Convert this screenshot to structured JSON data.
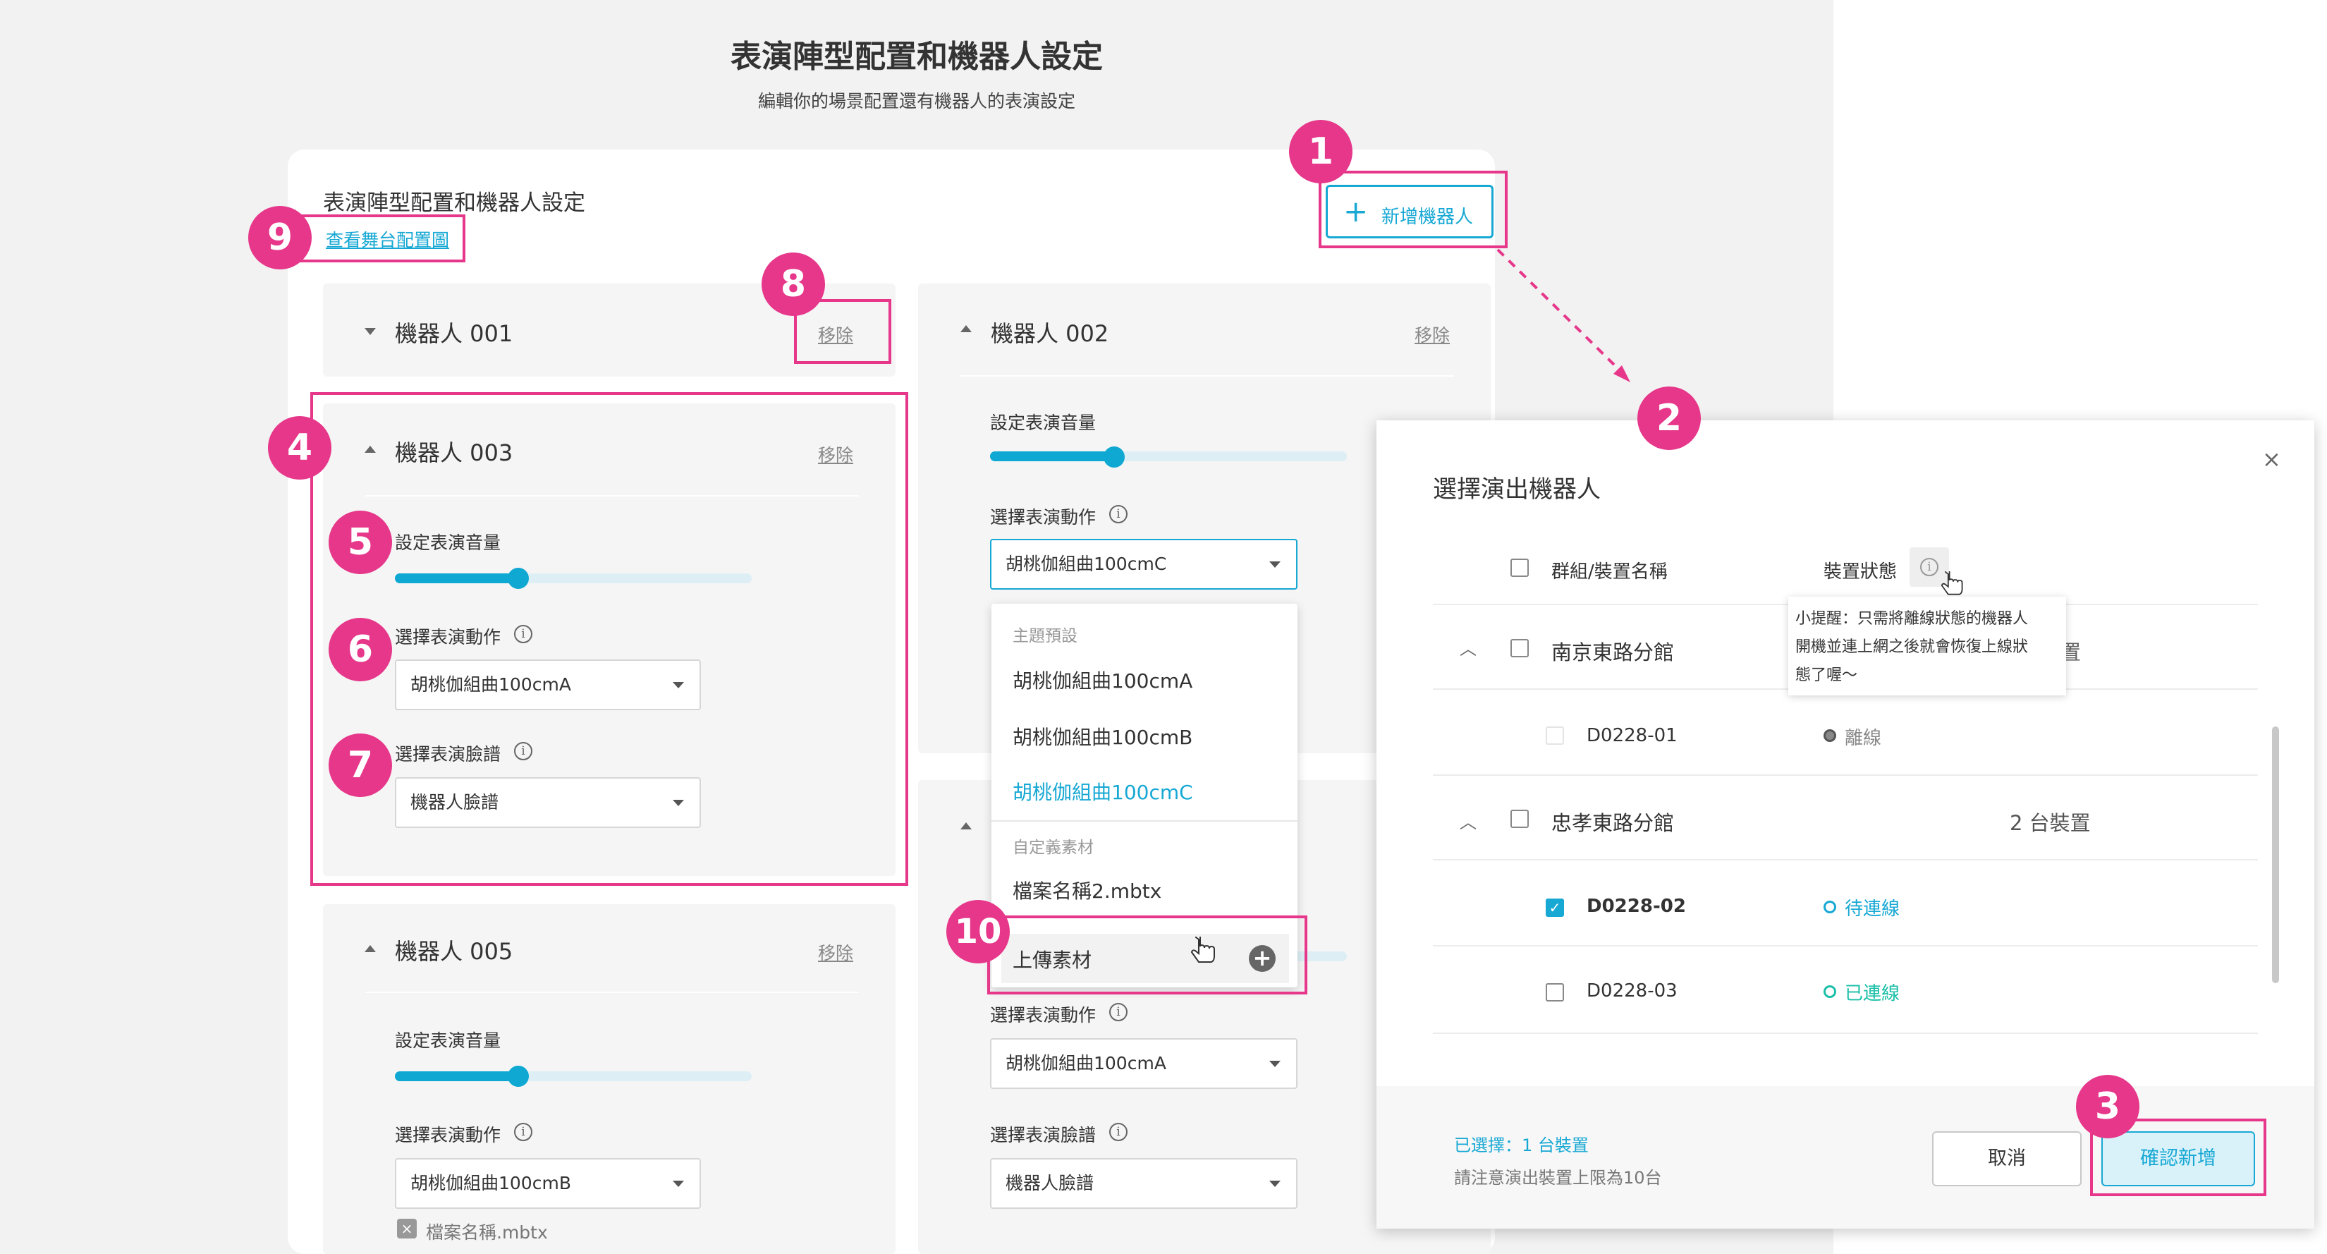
{
  "page": {
    "title": "表演陣型配置和機器人設定",
    "subtitle": "編輯你的場景配置還有機器人的表演設定"
  },
  "card": {
    "title": "表演陣型配置和機器人設定",
    "stage_link": "查看舞台配置圖",
    "add_robot_label": "新增機器人"
  },
  "common": {
    "remove_label": "移除",
    "volume_label": "設定表演音量",
    "action_label": "選擇表演動作",
    "face_label": "選擇表演臉譜"
  },
  "robots": [
    {
      "name": "機器人 001",
      "collapsed": true
    },
    {
      "name": "機器人 003",
      "volume": 0.4,
      "action": "胡桃伽組曲100cmA",
      "face": "機器人臉譜"
    },
    {
      "name": "機器人 005",
      "volume": 0.4,
      "action": "胡桃伽組曲100cmB",
      "file": "檔案名稱.mbtx"
    },
    {
      "name": "機器人 002",
      "volume": 0.35,
      "action": "胡桃伽組曲100cmC"
    },
    {
      "action": "胡桃伽組曲100cmA",
      "face": "機器人臉譜"
    }
  ],
  "dropdown": {
    "group1": "主題預設",
    "items": [
      "胡桃伽組曲100cmA",
      "胡桃伽組曲100cmB",
      "胡桃伽組曲100cmC"
    ],
    "selected_index": 2,
    "group2": "自定義素材",
    "custom_item": "檔案名稱2.mbtx",
    "upload_label": "上傳素材"
  },
  "modal": {
    "title": "選擇演出機器人",
    "close_icon": "×",
    "col_name": "群組/裝置名稱",
    "col_status": "裝置狀態",
    "tooltip_lines": [
      "小提醒：只需將離線狀態的機器人",
      "開機並連上網之後就會恢復上線狀",
      "態了喔～"
    ],
    "tooltip_hidden_text": "置",
    "groups": [
      {
        "name": "南京東路分館",
        "devices": [
          {
            "id": "D0228-01",
            "status": "離線",
            "checked": false,
            "disabled": true
          }
        ]
      },
      {
        "name": "忠孝東路分館",
        "count": "2 台裝置",
        "devices": [
          {
            "id": "D0228-02",
            "status": "待連線",
            "checked": true
          },
          {
            "id": "D0228-03",
            "status": "已連線",
            "checked": false
          }
        ]
      }
    ],
    "selected_text": "已選擇：1 台裝置",
    "limit_text": "請注意演出裝置上限為10台",
    "cancel_label": "取消",
    "confirm_label": "確認新增"
  },
  "badges": [
    "1",
    "2",
    "3",
    "4",
    "5",
    "6",
    "7",
    "8",
    "9",
    "10"
  ],
  "colors": {
    "accent": "#17a8d4",
    "annotation": "#e6378a",
    "offline": "#888888",
    "pending": "#17a8d4",
    "online": "#1bbfa8"
  }
}
